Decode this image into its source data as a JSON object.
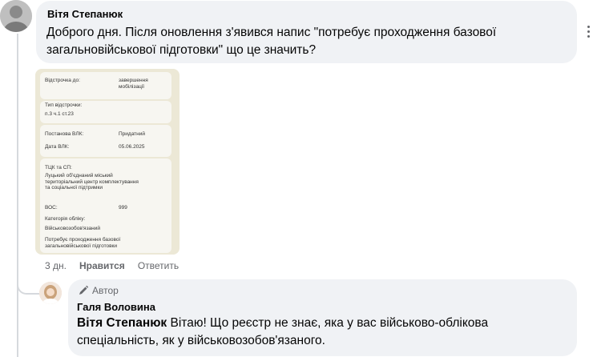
{
  "comment": {
    "author": "Вітя Степанюк",
    "text": "Доброго дня. Після оновлення з'явився напис \"потребує проходження базової загальновійськової підготовки\" що це значить?",
    "time": "3 дн.",
    "like_label": "Нравится",
    "reply_label": "Ответить"
  },
  "attachment": {
    "fields": [
      {
        "label": "Відстрочка до:",
        "value": "завершення\nмобілізації"
      },
      {
        "label": "Тип відстрочки:",
        "value": "п.3 ч.1 ст.23"
      },
      {
        "label": "Постанова ВЛК:",
        "value": "Придатний"
      },
      {
        "label": "Дата ВЛК:",
        "value": "05.06.2025"
      },
      {
        "label": "ТЦК та СП:",
        "value": "Луцький об'єднаний міський\nтериторіальний центр комплектування\nта соціальної підтримки"
      },
      {
        "label": "ВОС:",
        "value": "999"
      },
      {
        "label": "Категорія обліку:",
        "value": "Військовозобов'язаний"
      },
      {
        "label": "",
        "value": "Потребує проходження базової\nзагальновійськової підготовки"
      }
    ]
  },
  "reply": {
    "badge": "Автор",
    "author": "Галя Воловина",
    "mention": "Вітя Степанюк",
    "text": " Вітаю! Що реєстр не знає, яка у вас військово-облікова спеціальність, як у військовозобов'язаного."
  },
  "icons": {
    "more": "more-dots-icon",
    "badge": "pen-icon"
  }
}
